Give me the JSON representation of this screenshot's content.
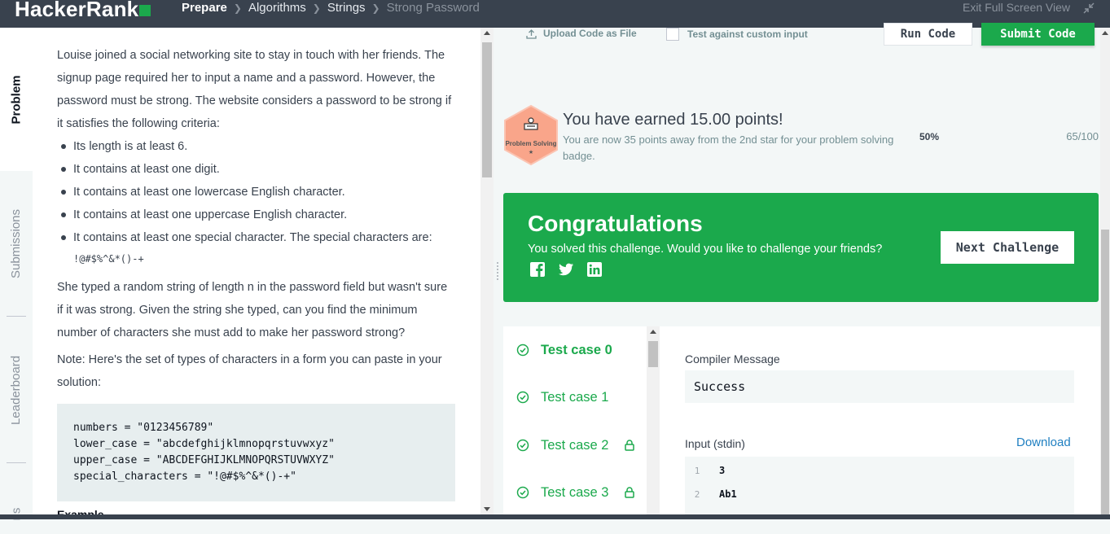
{
  "header": {
    "logo": "HackerRank",
    "breadcrumbs": [
      "Prepare",
      "Algorithms",
      "Strings",
      "Strong Password"
    ],
    "exit_fullscreen": "Exit Full Screen View"
  },
  "side_tabs": [
    "Problem",
    "Submissions",
    "Leaderboard",
    "ns"
  ],
  "problem": {
    "intro": "Louise joined a social networking site to stay in touch with her friends. The signup page required her to input a name and a password. However, the password must be strong. The website considers a password to be strong if it satisfies the following criteria:",
    "criteria": [
      "Its length is at least 6.",
      "It contains at least one digit.",
      "It contains at least one lowercase English character.",
      "It contains at least one uppercase English character.",
      "It contains at least one special character. The special characters are:"
    ],
    "special_chars": "!@#$%^&*()-+",
    "para2": "She typed a random string of length n in the password field but wasn't sure if it was strong. Given the string she typed, can you find the minimum number of characters she must add to make her password strong?",
    "note": "Note: Here's the set of types of characters in a form you can paste in your solution:",
    "code": "numbers = \"0123456789\"\nlower_case = \"abcdefghijklmnopqrstuvwxyz\"\nupper_case = \"ABCDEFGHIJKLMNOPQRSTUVWXYZ\"\nspecial_characters = \"!@#$%^&*()-+\"",
    "example_heading": "Example"
  },
  "editor_toolbar": {
    "upload_label": "Upload Code as File",
    "custom_input_label": "Test against custom input",
    "run_label": "Run Code",
    "submit_label": "Submit Code"
  },
  "points": {
    "badge_label": "Problem Solving",
    "badge_stars": "★",
    "earned": "You have earned 15.00 points!",
    "sub": "You are now 35 points away from the 2nd star for your problem solving badge.",
    "percent": "50%",
    "progress": "65/100"
  },
  "congrats": {
    "title": "Congratulations",
    "subtitle": "You solved this challenge. Would you like to challenge your friends?",
    "next_label": "Next Challenge"
  },
  "test_cases": [
    {
      "label": "Test case 0",
      "locked": false
    },
    {
      "label": "Test case 1",
      "locked": false
    },
    {
      "label": "Test case 2",
      "locked": true
    },
    {
      "label": "Test case 3",
      "locked": true
    }
  ],
  "output": {
    "compiler_label": "Compiler Message",
    "compiler_value": "Success",
    "input_label": "Input (stdin)",
    "download_label": "Download",
    "input_lines": [
      {
        "num": "1",
        "text": "3"
      },
      {
        "num": "2",
        "text": "Ab1"
      }
    ]
  },
  "colors": {
    "accent_green": "#1ba94c",
    "topbar": "#39424e",
    "link_blue": "#1f7fc1",
    "badge_orange": "#f9a58a"
  }
}
